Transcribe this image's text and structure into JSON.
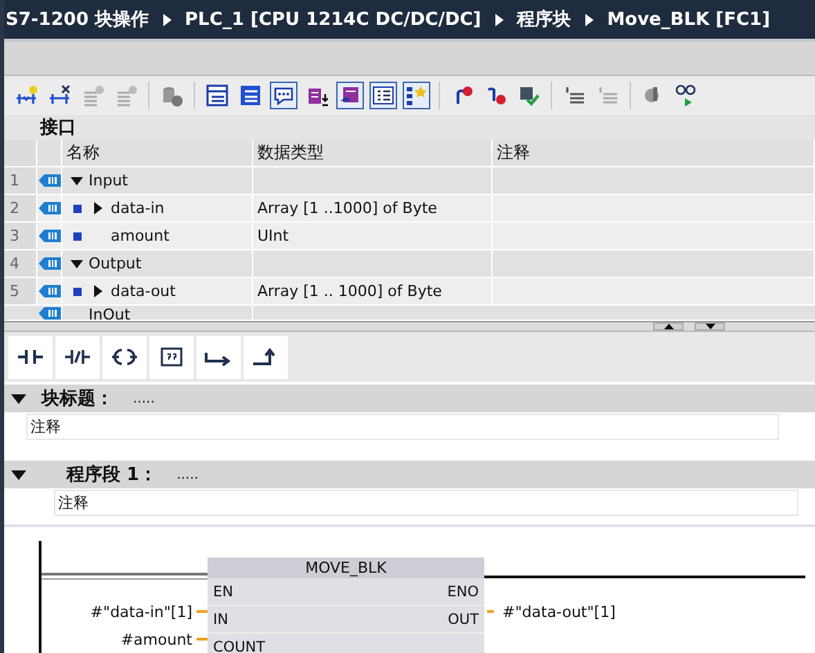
{
  "breadcrumb": [
    "S7-1200 块操作",
    "PLC_1 [CPU 1214C DC/DC/DC]",
    "程序块",
    "Move_BLK [FC1]"
  ],
  "toolbar": [
    {
      "on": false
    },
    {
      "on": false
    },
    {
      "on": false
    },
    {
      "on": false
    },
    {
      "on": false
    },
    {
      "on": false
    },
    {
      "on": false
    },
    {
      "on": true
    },
    {
      "on": false
    },
    {
      "on": true
    },
    {
      "on": true
    },
    {
      "on": true
    },
    {
      "on": false
    },
    {
      "on": false
    },
    {
      "on": false
    },
    {
      "on": false
    },
    {
      "on": false
    },
    {
      "on": false
    },
    {
      "on": false
    }
  ],
  "interface": {
    "title": "接口",
    "columns": [
      "名称",
      "数据类型",
      "注释"
    ],
    "rows": [
      {
        "number": "1",
        "name": "Input",
        "expanded": true,
        "children": [
          {
            "number": "2",
            "name": "data-in",
            "data_type": "Array [1 ..1000] of Byte",
            "expanded": false
          },
          {
            "number": "3",
            "name": "amount",
            "data_type": "UInt"
          }
        ]
      },
      {
        "number": "4",
        "name": "Output",
        "expanded": true,
        "children": [
          {
            "number": "5",
            "name": "data-out",
            "data_type": "Array [1 .. 1000] of Byte",
            "expanded": false
          }
        ]
      },
      {
        "name": "InOut"
      }
    ]
  },
  "block_title": {
    "label": "块标题：",
    "value": ".....",
    "expanded": true,
    "comment": "注释"
  },
  "networks": [
    {
      "label": "程序段 1：",
      "value": ".....",
      "expanded": true,
      "comment": "注释",
      "box": {
        "title": "MOVE_BLK",
        "inputs": [
          {
            "pin": "EN"
          },
          {
            "pin": "IN",
            "operand": "#\"data-in\"[1]"
          },
          {
            "pin": "COUNT",
            "operand": "#amount"
          }
        ],
        "outputs": [
          {
            "pin": "ENO"
          },
          {
            "pin": "OUT",
            "operand": "#\"data-out\"[1]"
          }
        ]
      }
    }
  ]
}
